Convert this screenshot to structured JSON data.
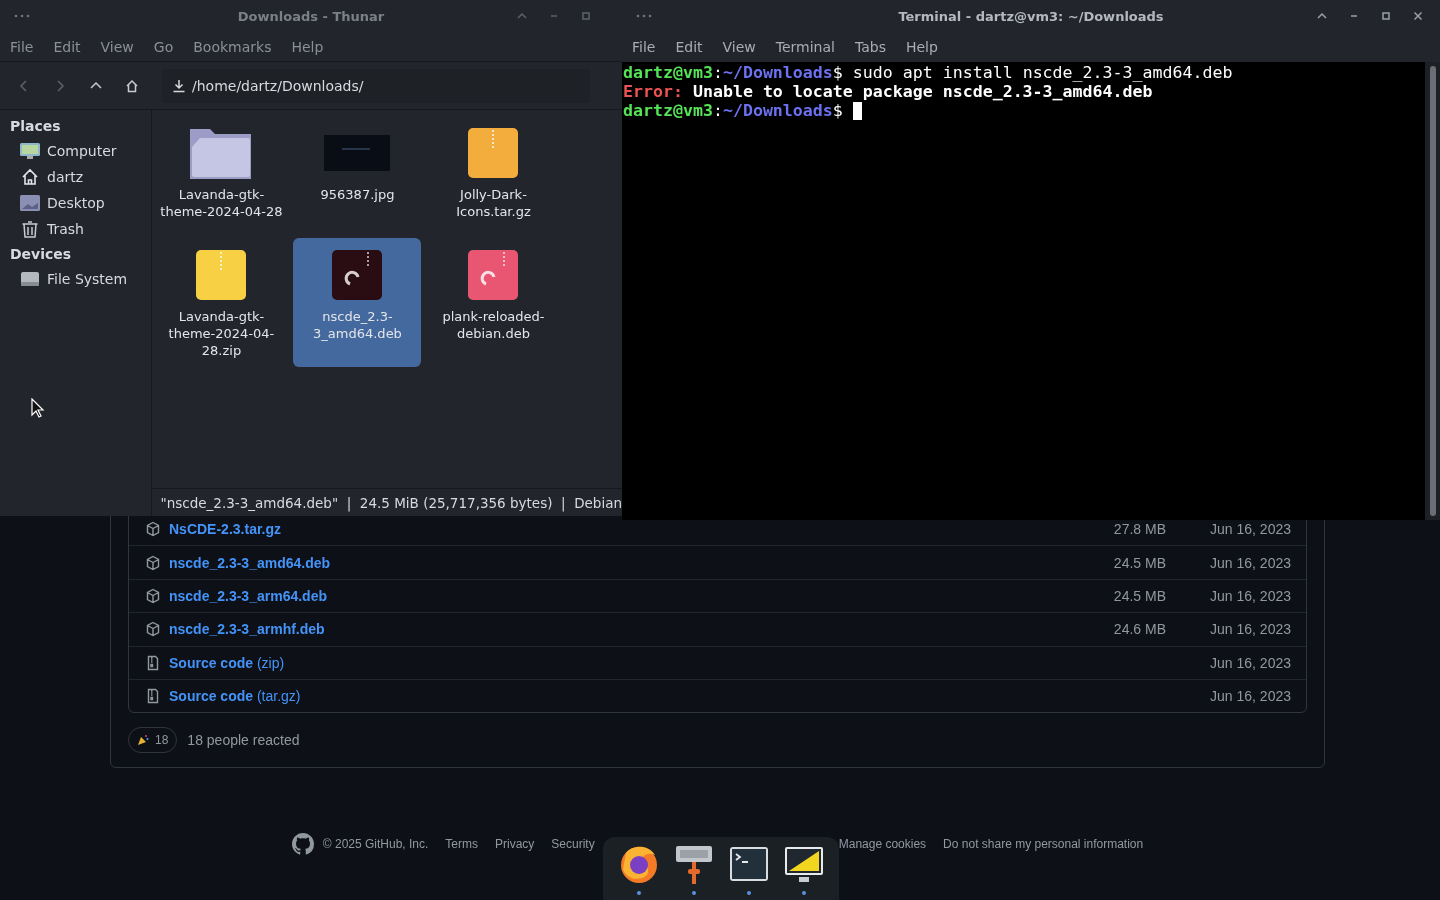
{
  "thunar": {
    "title": "Downloads - Thunar",
    "menu": [
      "File",
      "Edit",
      "View",
      "Go",
      "Bookmarks",
      "Help"
    ],
    "location": "/home/dartz/Downloads/",
    "sections": [
      {
        "heading": "Places",
        "items": [
          {
            "kind": "computer",
            "label": "Computer"
          },
          {
            "kind": "home",
            "label": "dartz"
          },
          {
            "kind": "desktop",
            "label": "Desktop"
          },
          {
            "kind": "trash",
            "label": "Trash"
          }
        ]
      },
      {
        "heading": "Devices",
        "items": [
          {
            "kind": "drive",
            "label": "File System"
          }
        ]
      }
    ],
    "files": [
      {
        "kind": "folder",
        "name": "Lavanda-gtk-theme-2024-04-28",
        "selected": false
      },
      {
        "kind": "image",
        "name": "956387.jpg",
        "selected": false
      },
      {
        "kind": "archive",
        "color": "#f2ad3c",
        "name": "Jolly-Dark-Icons.tar.gz",
        "selected": false
      },
      {
        "kind": "archive",
        "color": "#f7d044",
        "name": "Lavanda-gtk-theme-2024-04-28.zip",
        "selected": false
      },
      {
        "kind": "package",
        "color": "#2a0d12",
        "name": "nscde_2.3-3_amd64.deb",
        "selected": true
      },
      {
        "kind": "package",
        "color": "#e85672",
        "name": "plank-reloaded-debian.deb",
        "selected": false
      }
    ],
    "status": "\"nscde_2.3-3_amd64.deb\"  |  24.5 MiB (25,717,356 bytes)  |  Debian"
  },
  "terminal": {
    "title": "Terminal - dartz@vm3: ~/Downloads",
    "menu": [
      "File",
      "Edit",
      "View",
      "Terminal",
      "Tabs",
      "Help"
    ],
    "lines": [
      {
        "segments": [
          {
            "kind": "user",
            "text": "dartz@vm3"
          },
          {
            "kind": "plain",
            "text": ":"
          },
          {
            "kind": "path",
            "text": "~/Downloads"
          },
          {
            "kind": "plain",
            "text": "$ sudo apt install nscde_2.3-3_amd64.deb"
          }
        ],
        "cursor": false
      },
      {
        "segments": [
          {
            "kind": "error",
            "text": "Error:"
          },
          {
            "kind": "bold",
            "text": " Unable to locate package nscde_2.3-3_amd64.deb"
          }
        ],
        "cursor": false
      },
      {
        "segments": [
          {
            "kind": "user",
            "text": "dartz@vm3"
          },
          {
            "kind": "plain",
            "text": ":"
          },
          {
            "kind": "path",
            "text": "~/Downloads"
          },
          {
            "kind": "plain",
            "text": "$ "
          }
        ],
        "cursor": true
      }
    ]
  },
  "release": {
    "assets": [
      {
        "kind": "package",
        "name": "NsCDE-2.3.tar.gz",
        "size": "27.8 MB",
        "date": "Jun 16, 2023"
      },
      {
        "kind": "package",
        "name": "nscde_2.3-3_amd64.deb",
        "size": "24.5 MB",
        "date": "Jun 16, 2023"
      },
      {
        "kind": "package",
        "name": "nscde_2.3-3_arm64.deb",
        "size": "24.5 MB",
        "date": "Jun 16, 2023"
      },
      {
        "kind": "package",
        "name": "nscde_2.3-3_armhf.deb",
        "size": "24.6 MB",
        "date": "Jun 16, 2023"
      },
      {
        "kind": "source",
        "name": "Source code",
        "suffix": "(zip)",
        "date": "Jun 16, 2023"
      },
      {
        "kind": "source",
        "name": "Source code",
        "suffix": "(tar.gz)",
        "date": "Jun 16, 2023"
      }
    ],
    "reaction_count": "18",
    "reaction_text": "18 people reacted"
  },
  "footer": {
    "copyright": "© 2025 GitHub, Inc.",
    "links_left": [
      "Terms",
      "Privacy",
      "Security"
    ],
    "links_right": [
      "Manage cookies",
      "Do not share my personal information"
    ]
  },
  "dock": [
    {
      "kind": "browser",
      "running": true
    },
    {
      "kind": "keyboard",
      "running": true
    },
    {
      "kind": "terminal",
      "running": true
    },
    {
      "kind": "geometry",
      "running": true
    }
  ]
}
